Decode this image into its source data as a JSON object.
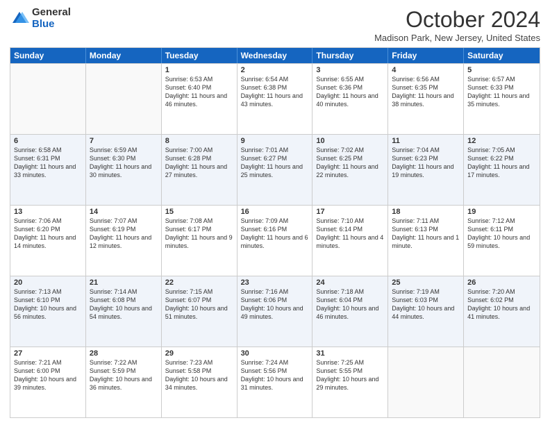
{
  "logo": {
    "general": "General",
    "blue": "Blue"
  },
  "header": {
    "month": "October 2024",
    "location": "Madison Park, New Jersey, United States"
  },
  "weekdays": [
    "Sunday",
    "Monday",
    "Tuesday",
    "Wednesday",
    "Thursday",
    "Friday",
    "Saturday"
  ],
  "rows": [
    [
      {
        "day": "",
        "info": ""
      },
      {
        "day": "",
        "info": ""
      },
      {
        "day": "1",
        "info": "Sunrise: 6:53 AM\nSunset: 6:40 PM\nDaylight: 11 hours and 46 minutes."
      },
      {
        "day": "2",
        "info": "Sunrise: 6:54 AM\nSunset: 6:38 PM\nDaylight: 11 hours and 43 minutes."
      },
      {
        "day": "3",
        "info": "Sunrise: 6:55 AM\nSunset: 6:36 PM\nDaylight: 11 hours and 40 minutes."
      },
      {
        "day": "4",
        "info": "Sunrise: 6:56 AM\nSunset: 6:35 PM\nDaylight: 11 hours and 38 minutes."
      },
      {
        "day": "5",
        "info": "Sunrise: 6:57 AM\nSunset: 6:33 PM\nDaylight: 11 hours and 35 minutes."
      }
    ],
    [
      {
        "day": "6",
        "info": "Sunrise: 6:58 AM\nSunset: 6:31 PM\nDaylight: 11 hours and 33 minutes."
      },
      {
        "day": "7",
        "info": "Sunrise: 6:59 AM\nSunset: 6:30 PM\nDaylight: 11 hours and 30 minutes."
      },
      {
        "day": "8",
        "info": "Sunrise: 7:00 AM\nSunset: 6:28 PM\nDaylight: 11 hours and 27 minutes."
      },
      {
        "day": "9",
        "info": "Sunrise: 7:01 AM\nSunset: 6:27 PM\nDaylight: 11 hours and 25 minutes."
      },
      {
        "day": "10",
        "info": "Sunrise: 7:02 AM\nSunset: 6:25 PM\nDaylight: 11 hours and 22 minutes."
      },
      {
        "day": "11",
        "info": "Sunrise: 7:04 AM\nSunset: 6:23 PM\nDaylight: 11 hours and 19 minutes."
      },
      {
        "day": "12",
        "info": "Sunrise: 7:05 AM\nSunset: 6:22 PM\nDaylight: 11 hours and 17 minutes."
      }
    ],
    [
      {
        "day": "13",
        "info": "Sunrise: 7:06 AM\nSunset: 6:20 PM\nDaylight: 11 hours and 14 minutes."
      },
      {
        "day": "14",
        "info": "Sunrise: 7:07 AM\nSunset: 6:19 PM\nDaylight: 11 hours and 12 minutes."
      },
      {
        "day": "15",
        "info": "Sunrise: 7:08 AM\nSunset: 6:17 PM\nDaylight: 11 hours and 9 minutes."
      },
      {
        "day": "16",
        "info": "Sunrise: 7:09 AM\nSunset: 6:16 PM\nDaylight: 11 hours and 6 minutes."
      },
      {
        "day": "17",
        "info": "Sunrise: 7:10 AM\nSunset: 6:14 PM\nDaylight: 11 hours and 4 minutes."
      },
      {
        "day": "18",
        "info": "Sunrise: 7:11 AM\nSunset: 6:13 PM\nDaylight: 11 hours and 1 minute."
      },
      {
        "day": "19",
        "info": "Sunrise: 7:12 AM\nSunset: 6:11 PM\nDaylight: 10 hours and 59 minutes."
      }
    ],
    [
      {
        "day": "20",
        "info": "Sunrise: 7:13 AM\nSunset: 6:10 PM\nDaylight: 10 hours and 56 minutes."
      },
      {
        "day": "21",
        "info": "Sunrise: 7:14 AM\nSunset: 6:08 PM\nDaylight: 10 hours and 54 minutes."
      },
      {
        "day": "22",
        "info": "Sunrise: 7:15 AM\nSunset: 6:07 PM\nDaylight: 10 hours and 51 minutes."
      },
      {
        "day": "23",
        "info": "Sunrise: 7:16 AM\nSunset: 6:06 PM\nDaylight: 10 hours and 49 minutes."
      },
      {
        "day": "24",
        "info": "Sunrise: 7:18 AM\nSunset: 6:04 PM\nDaylight: 10 hours and 46 minutes."
      },
      {
        "day": "25",
        "info": "Sunrise: 7:19 AM\nSunset: 6:03 PM\nDaylight: 10 hours and 44 minutes."
      },
      {
        "day": "26",
        "info": "Sunrise: 7:20 AM\nSunset: 6:02 PM\nDaylight: 10 hours and 41 minutes."
      }
    ],
    [
      {
        "day": "27",
        "info": "Sunrise: 7:21 AM\nSunset: 6:00 PM\nDaylight: 10 hours and 39 minutes."
      },
      {
        "day": "28",
        "info": "Sunrise: 7:22 AM\nSunset: 5:59 PM\nDaylight: 10 hours and 36 minutes."
      },
      {
        "day": "29",
        "info": "Sunrise: 7:23 AM\nSunset: 5:58 PM\nDaylight: 10 hours and 34 minutes."
      },
      {
        "day": "30",
        "info": "Sunrise: 7:24 AM\nSunset: 5:56 PM\nDaylight: 10 hours and 31 minutes."
      },
      {
        "day": "31",
        "info": "Sunrise: 7:25 AM\nSunset: 5:55 PM\nDaylight: 10 hours and 29 minutes."
      },
      {
        "day": "",
        "info": ""
      },
      {
        "day": "",
        "info": ""
      }
    ]
  ]
}
